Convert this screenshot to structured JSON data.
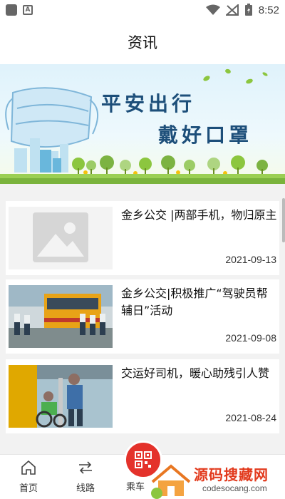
{
  "status_bar": {
    "time": "8:52",
    "a_badge": "A"
  },
  "header": {
    "title": "资讯"
  },
  "banner": {
    "line1": "平安出行",
    "line2": "戴好口罩"
  },
  "news": [
    {
      "title": "金乡公交 |两部手机，物归原主",
      "date": "2021-09-13",
      "thumb": "placeholder-image-icon"
    },
    {
      "title": "金乡公交|积极推广“驾驶员帮辅日”活动",
      "date": "2021-09-08",
      "thumb": "bus-cleaning-photo"
    },
    {
      "title": "交运好司机，暖心助残引人赞",
      "date": "2021-08-24",
      "thumb": "bus-interior-photo"
    }
  ],
  "nav": {
    "home": "首页",
    "route": "线路",
    "ride": "乘车"
  },
  "watermark": {
    "title": "源码搜藏网",
    "url": "codesocang.com"
  },
  "colors": {
    "accent": "#e4322b",
    "banner_text": "#1d4f7a"
  }
}
